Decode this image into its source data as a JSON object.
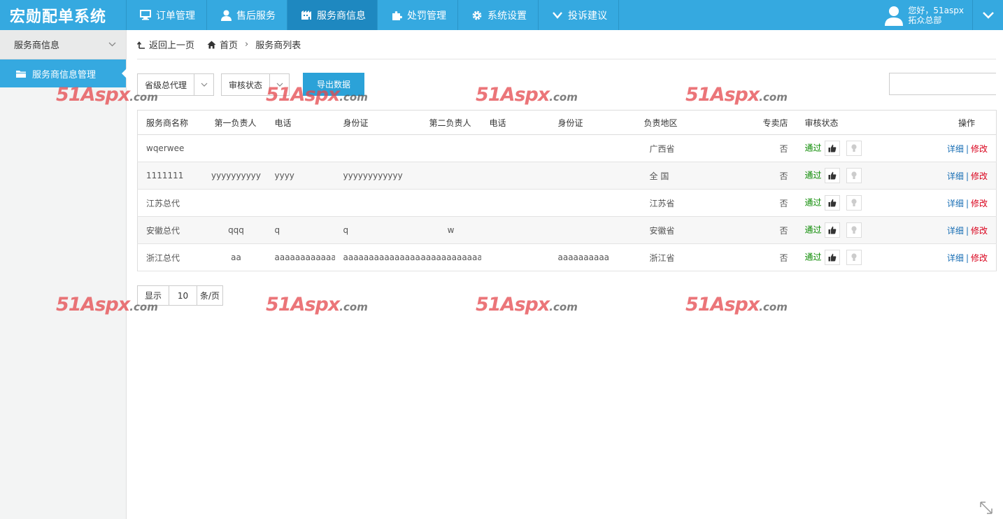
{
  "app": {
    "logo": "宏勋配单系统"
  },
  "nav": {
    "items": [
      {
        "label": "订单管理",
        "icon": "monitor-icon"
      },
      {
        "label": "售后服务",
        "icon": "user-icon"
      },
      {
        "label": "服务商信息",
        "icon": "building-icon",
        "active": true
      },
      {
        "label": "处罚管理",
        "icon": "puzzle-icon"
      },
      {
        "label": "系统设置",
        "icon": "gear-icon"
      },
      {
        "label": "投诉建议",
        "icon": "chevron-down-icon"
      }
    ]
  },
  "user": {
    "greeting": "您好，51aspx",
    "org": "拓众总部"
  },
  "sidebar": {
    "group": "服务商信息",
    "items": [
      {
        "label": "服务商信息管理",
        "icon": "folder-icon"
      }
    ]
  },
  "breadcrumb": {
    "back": "返回上一页",
    "home": "首页",
    "current": "服务商列表"
  },
  "filters": {
    "level": "省级总代理",
    "status": "审核状态",
    "export_label": "导出数据",
    "search_placeholder": ""
  },
  "table": {
    "headers": [
      "服务商名称",
      "第一负责人",
      "电话",
      "身份证",
      "第二负责人",
      "电话",
      "身份证",
      "负责地区",
      "专卖店",
      "审核状态",
      "操作"
    ],
    "rows": [
      {
        "name": "wqerwee",
        "p1": "",
        "tel1": "",
        "id1": "",
        "p2": "",
        "tel2": "",
        "id2": "",
        "region": "广西省",
        "store": "否",
        "status": "通过"
      },
      {
        "name": "1111111",
        "p1": "yyyyyyyyyy",
        "tel1": "yyyy",
        "id1": "yyyyyyyyyyyy",
        "p2": "",
        "tel2": "",
        "id2": "",
        "region": "全 国",
        "store": "否",
        "status": "通过"
      },
      {
        "name": "江苏总代",
        "p1": "",
        "tel1": "",
        "id1": "",
        "p2": "",
        "tel2": "",
        "id2": "",
        "region": "江苏省",
        "store": "否",
        "status": "通过"
      },
      {
        "name": "安徽总代",
        "p1": "qqq",
        "tel1": "q",
        "id1": "q",
        "p2": "w",
        "tel2": "",
        "id2": "",
        "region": "安徽省",
        "store": "否",
        "status": "通过"
      },
      {
        "name": "浙江总代",
        "p1": "aa",
        "tel1": "aaaaaaaaaaaa",
        "id1": "aaaaaaaaaaaaaaaa",
        "p2": "aaaaaaaaaaaaaaaaaaaaaaaa",
        "tel2": "",
        "id2": "aaaaaaaaaa",
        "region": "浙江省",
        "store": "否",
        "status": "通过"
      }
    ],
    "action_detail": "详细",
    "action_sep": "|",
    "action_edit": "修改"
  },
  "pager": {
    "show": "显示",
    "size": "10",
    "unit": "条/页"
  },
  "watermark": {
    "brand": "51Aspx",
    "suffix": ".com"
  },
  "colors": {
    "primary": "#35a9e0",
    "active_nav": "#1e88c0",
    "pass": "#0a8a00",
    "edit": "#d9001b",
    "detail": "#1a6fb5"
  }
}
